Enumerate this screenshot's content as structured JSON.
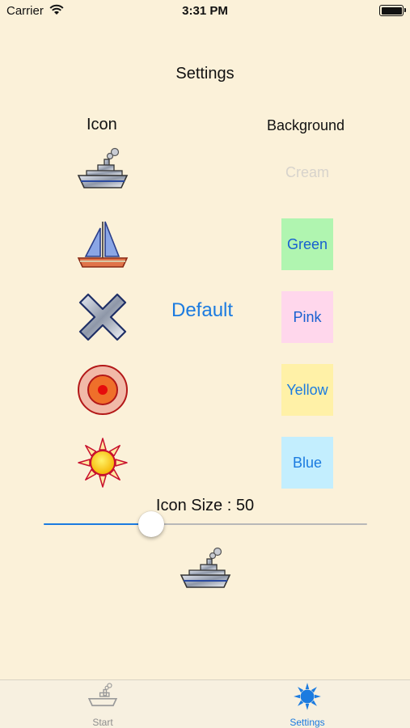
{
  "status_bar": {
    "carrier": "Carrier",
    "time": "3:31 PM",
    "wifi_icon": "wifi-icon",
    "battery_icon": "battery-icon"
  },
  "header": {
    "title": "Settings"
  },
  "columns": {
    "icon_heading": "Icon",
    "background_heading": "Background"
  },
  "icons": [
    {
      "name": "ship-icon"
    },
    {
      "name": "sailboat-icon"
    },
    {
      "name": "x-mark-icon"
    },
    {
      "name": "target-icon"
    },
    {
      "name": "sun-icon"
    }
  ],
  "default_button": {
    "label": "Default"
  },
  "backgrounds": [
    {
      "label": "Cream",
      "color": "#fbf1d9"
    },
    {
      "label": "Green",
      "color": "#b0f5b0"
    },
    {
      "label": "Pink",
      "color": "#ffd7ec"
    },
    {
      "label": "Yellow",
      "color": "#fff1a7"
    },
    {
      "label": "Blue",
      "color": "#c3eefe"
    }
  ],
  "icon_size": {
    "label": "Icon Size : 50",
    "value": 50,
    "min": 0,
    "max": 150
  },
  "tab_bar": {
    "tabs": [
      {
        "label": "Start",
        "icon": "ship-icon",
        "selected": false
      },
      {
        "label": "Settings",
        "icon": "sun-icon",
        "selected": true
      }
    ]
  },
  "colors": {
    "accent": "#1b7be0",
    "background": "#fbf1d9"
  }
}
